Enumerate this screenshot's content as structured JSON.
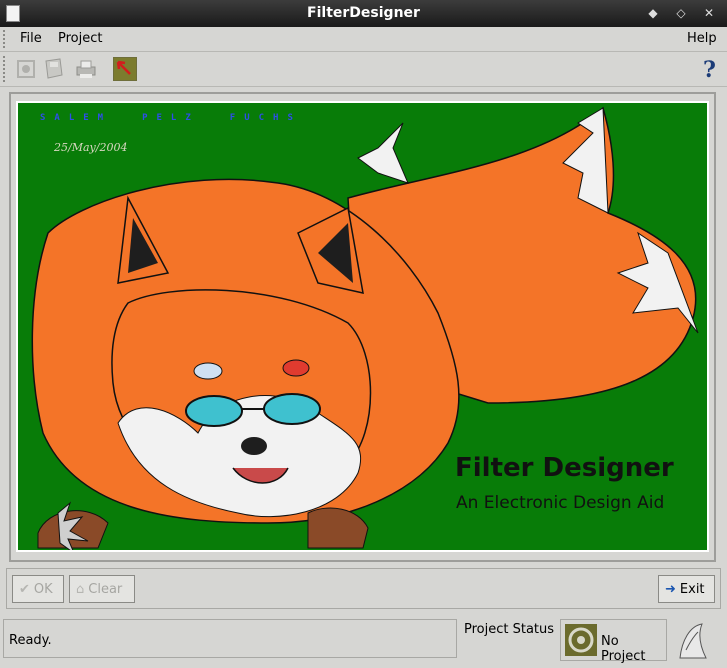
{
  "window": {
    "title": "FilterDesigner"
  },
  "menubar": {
    "file": "File",
    "project": "Project",
    "help": "Help"
  },
  "toolbar": {
    "items": [
      {
        "icon": "settings-icon"
      },
      {
        "icon": "save-icon"
      },
      {
        "icon": "print-icon"
      },
      {
        "icon": "pointer-arrow-icon"
      }
    ],
    "help_icon": "help-icon"
  },
  "splash": {
    "credits": [
      "SALEM",
      "PELZ",
      "FUCHS"
    ],
    "date": "25/May/2004",
    "title": "Filter Designer",
    "subtitle": "An Electronic Design Aid",
    "colors": {
      "background": "#087c08",
      "fox": "#f47428",
      "fur_light": "#f2f2f2",
      "dark": "#1e1e1e"
    }
  },
  "buttons": {
    "ok": "OK",
    "clear": "Clear",
    "exit": "Exit"
  },
  "status": {
    "message": "Ready.",
    "project_status_label": "Project Status",
    "project_value": "No Project"
  }
}
